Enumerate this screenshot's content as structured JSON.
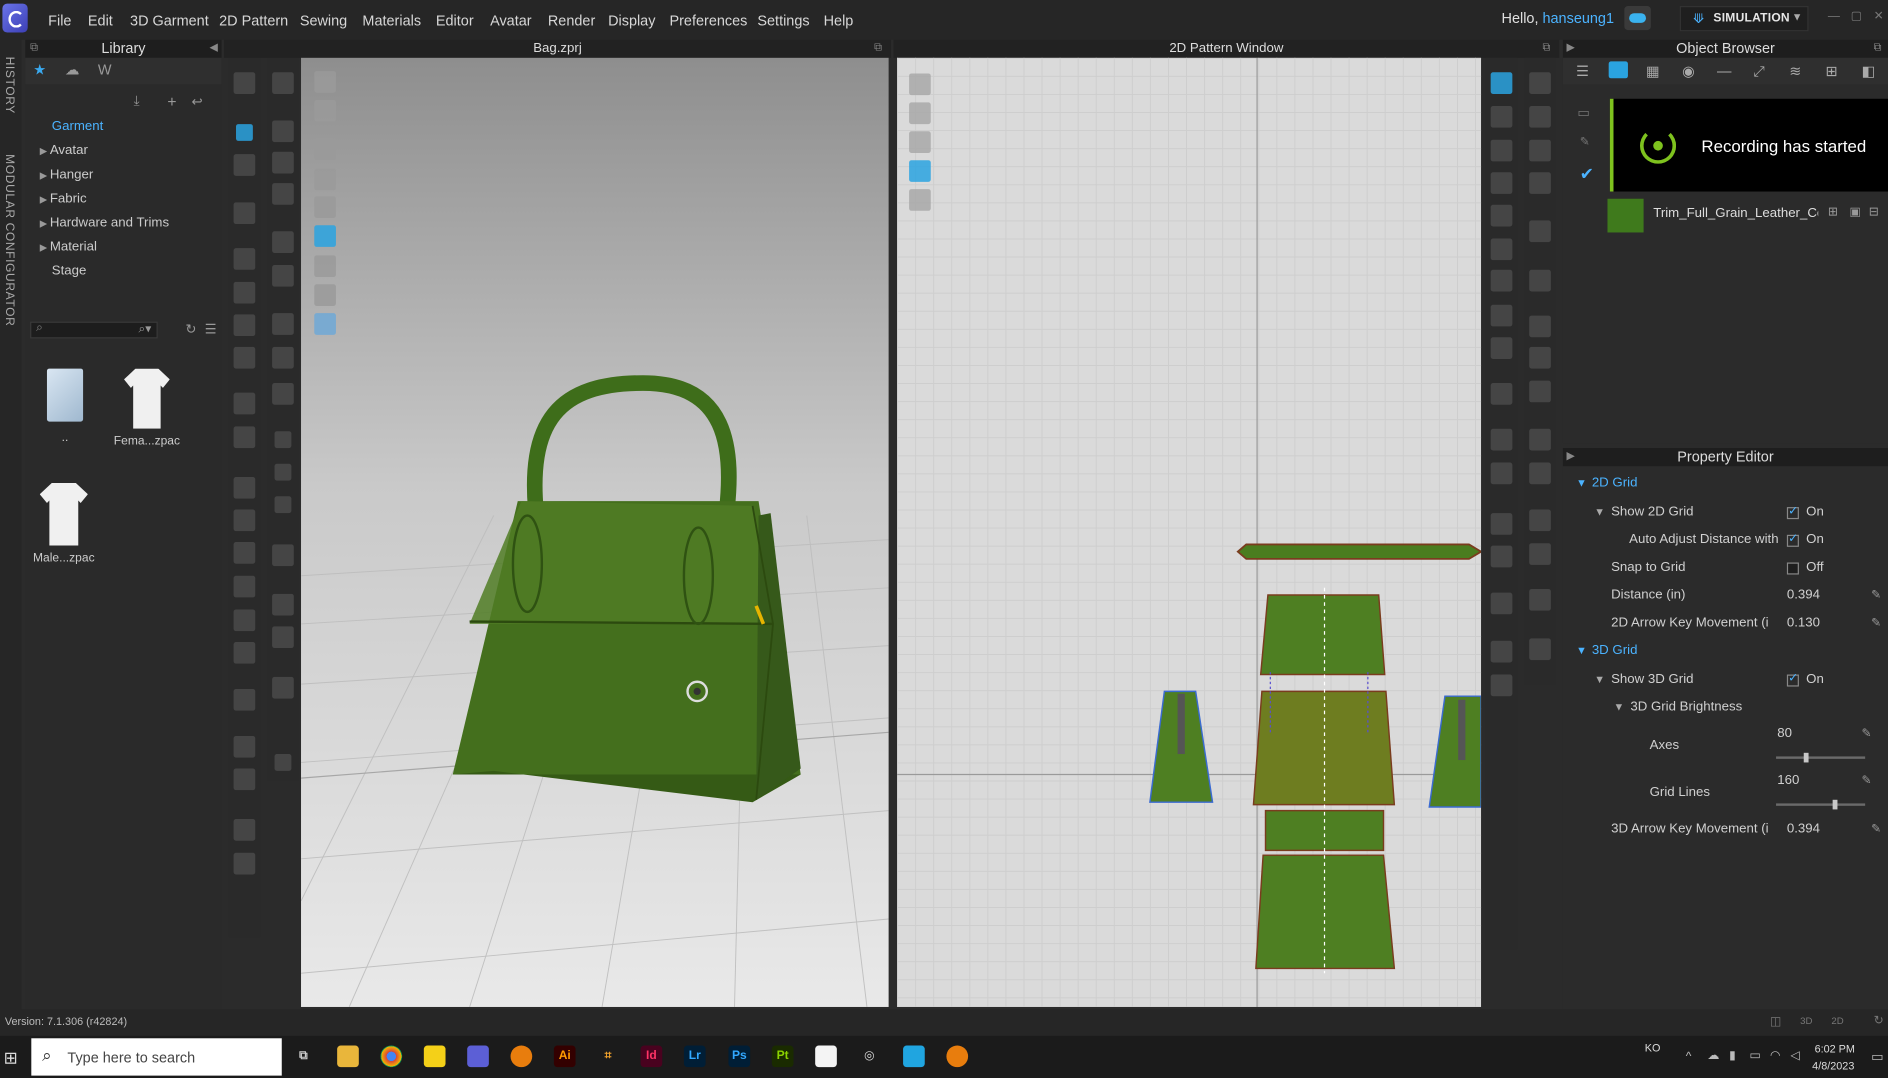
{
  "menubar": {
    "items": [
      "File",
      "Edit",
      "3D Garment",
      "2D Pattern",
      "Sewing",
      "Materials",
      "Editor",
      "Avatar",
      "Render",
      "Display",
      "Preferences",
      "Settings",
      "Help"
    ],
    "greeting": "Hello,",
    "username": "hanseung1",
    "mode_button": "SIMULATION"
  },
  "leftstrip": {
    "history": "HISTORY",
    "modular": "MODULAR CONFIGURATOR"
  },
  "library": {
    "title": "Library",
    "tree": [
      "Garment",
      "Avatar",
      "Hanger",
      "Fabric",
      "Hardware and Trims",
      "Material",
      "Stage"
    ],
    "thumbs": [
      "..",
      "Fema...zpac",
      "Male...zpac"
    ]
  },
  "viewport3d": {
    "title": "Bag.zprj"
  },
  "viewport2d": {
    "title": "2D Pattern Window"
  },
  "object_browser": {
    "title": "Object Browser",
    "toast": "Recording has started",
    "material_item": "Trim_Full_Grain_Leather_Co|"
  },
  "property_editor": {
    "title": "Property Editor",
    "section_2d": "2D Grid",
    "show_2d_grid": {
      "label": "Show 2D Grid",
      "value": "On"
    },
    "auto_adjust": {
      "label": "Auto Adjust Distance with",
      "value": "On"
    },
    "snap_to_grid": {
      "label": "Snap to Grid",
      "value": "Off"
    },
    "distance": {
      "label": "Distance (in)",
      "value": "0.394"
    },
    "arrow_2d": {
      "label": "2D Arrow Key Movement (i",
      "value": "0.130"
    },
    "section_3d": "3D Grid",
    "show_3d_grid": {
      "label": "Show 3D Grid",
      "value": "On"
    },
    "brightness": {
      "label": "3D Grid Brightness"
    },
    "axes": {
      "label": "Axes",
      "value": "80",
      "level": 0.31
    },
    "grid_lines": {
      "label": "Grid Lines",
      "value": "160",
      "level": 0.63
    },
    "arrow_3d": {
      "label": "3D Arrow Key Movement (i",
      "value": "0.394"
    }
  },
  "status": {
    "version": "Version: 7.1.306 (r42824)"
  },
  "taskbar": {
    "search_placeholder": "Type here to search",
    "time": "6:02 PM",
    "date": "4/8/2023",
    "lang": "KO",
    "apps": [
      "Ai",
      "Id",
      "Lr",
      "Ps",
      "Pt"
    ]
  },
  "colors": {
    "accent": "#4bb3ff",
    "garment_green": "#3f6e1c",
    "toast_green": "#7ec21e"
  }
}
